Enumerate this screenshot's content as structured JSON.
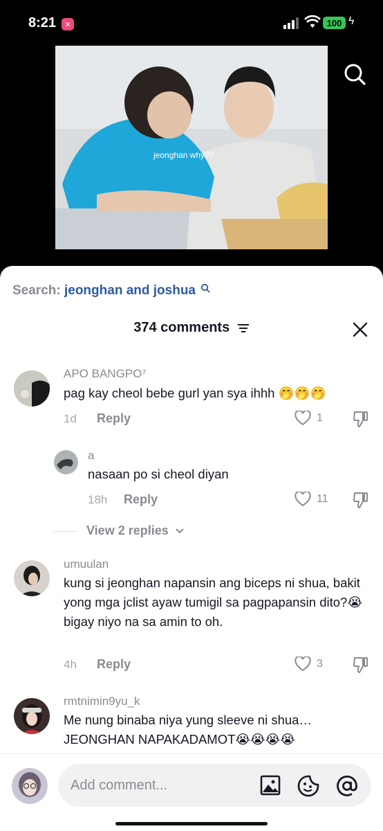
{
  "status": {
    "time": "8:21",
    "battery": "100"
  },
  "video": {
    "caption": "jeonghan why??"
  },
  "search": {
    "label": "Search:",
    "query": "jeonghan and joshua"
  },
  "comments_header": {
    "title": "374 comments"
  },
  "comments": [
    {
      "user": "APO BANGPO⁷",
      "text": "pag kay cheol bebe gurl yan sya ihhh 🤭🤭🤭",
      "time": "1d",
      "reply": "Reply",
      "likes": "1"
    },
    {
      "user": "a",
      "text": "nasaan po si cheol diyan",
      "time": "18h",
      "reply": "Reply",
      "likes": "11"
    },
    {
      "user": "umuulan",
      "text": "kung si jeonghan napansin ang biceps ni shua, bakit yong mga jclist ayaw tumigil sa pagpapansin dito?😭 bigay niyo na sa amin to oh.",
      "time": "4h",
      "reply": "Reply",
      "likes": "3"
    },
    {
      "user": "rmtnimin9yu_k",
      "text": "Me nung binaba niya yung sleeve ni shua… JEONGHAN NAPAKADAMOT😭😭😭😭"
    }
  ],
  "view_replies": "View 2 replies",
  "input": {
    "placeholder": "Add comment..."
  },
  "colors": {
    "accent_link": "#2e5b9e",
    "muted": "#8a8b91",
    "text": "#161823",
    "battery": "#34c759"
  }
}
